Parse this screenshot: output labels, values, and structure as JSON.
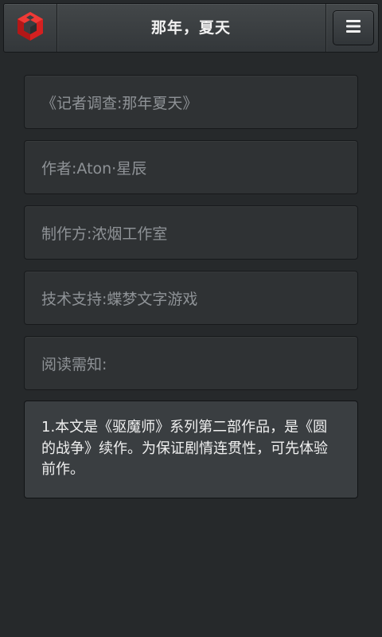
{
  "header": {
    "title": "那年，夏天",
    "logo_icon": "cube-logo-icon",
    "menu_icon": "hamburger-menu-icon",
    "logo_color": "#d42020"
  },
  "info": {
    "book_title": "《记者调查:那年夏天》",
    "author": "作者:Aton·星辰",
    "producer": "制作方:浓烟工作室",
    "support": "技术支持:蝶梦文字游戏",
    "notice_label": "阅读需知:"
  },
  "notice": {
    "text": "1.本文是《驱魔师》系列第二部作品，是《圆的战争》续作。为保证剧情连贯性，可先体验前作。"
  }
}
